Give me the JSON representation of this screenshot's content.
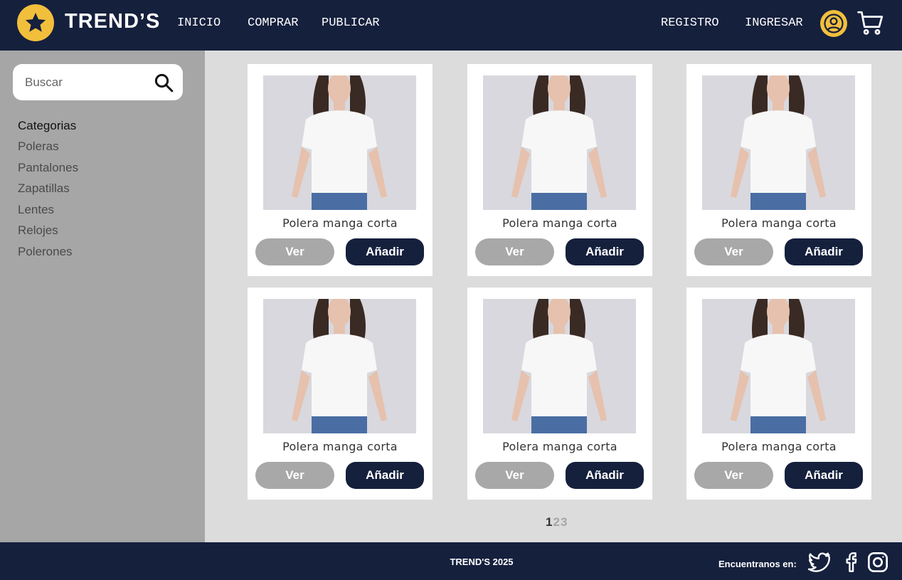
{
  "header": {
    "logo_text": "TREND’S",
    "nav": [
      "INICIO",
      "COMPRAR",
      "PUBLICAR"
    ],
    "auth": [
      "REGISTRO",
      "INGRESAR"
    ]
  },
  "sidebar": {
    "search_placeholder": "Buscar",
    "categories_title": "Categorias",
    "categories": [
      "Poleras",
      "Pantalones",
      "Zapatillas",
      "Lentes",
      "Relojes",
      "Polerones"
    ]
  },
  "products": [
    {
      "name": "Polera manga corta",
      "view_label": "Ver",
      "add_label": "Añadir"
    },
    {
      "name": "Polera manga corta",
      "view_label": "Ver",
      "add_label": "Añadir"
    },
    {
      "name": "Polera manga corta",
      "view_label": "Ver",
      "add_label": "Añadir"
    },
    {
      "name": "Polera manga corta",
      "view_label": "Ver",
      "add_label": "Añadir"
    },
    {
      "name": "Polera manga corta",
      "view_label": "Ver",
      "add_label": "Añadir"
    },
    {
      "name": "Polera manga corta",
      "view_label": "Ver",
      "add_label": "Añadir"
    }
  ],
  "pagination": {
    "pages": [
      "1",
      "2",
      "3"
    ],
    "current": "1"
  },
  "footer": {
    "copyright": "TREND'S 2025",
    "find_us": "Encuentranos en:",
    "social": [
      "twitter-icon",
      "facebook-icon",
      "instagram-icon"
    ]
  },
  "colors": {
    "navy": "#15203d",
    "accent_yellow": "#f2bf3c",
    "sidebar_gray": "#a6a6a6",
    "content_bg": "#dcdcdc",
    "button_gray": "#a8a8a8"
  }
}
